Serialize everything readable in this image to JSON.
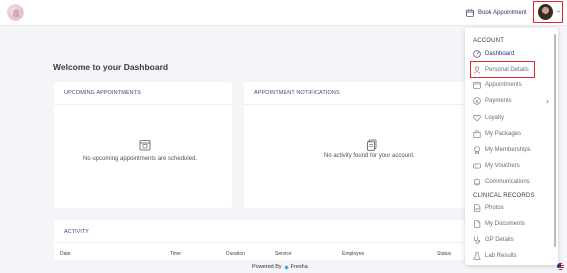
{
  "header": {
    "book_label": "Book Appointment"
  },
  "main": {
    "welcome": "Welcome to your Dashboard",
    "upcoming": {
      "title": "UPCOMING APPOINTMENTS",
      "empty_text": "No upcoming appointments are scheduled."
    },
    "notifications": {
      "title": "APPOINTMENT NOTIFICATIONS",
      "empty_text": "No activity found for your account."
    },
    "activity": {
      "title": "ACTIVITY",
      "columns": [
        "Date",
        "Time",
        "Duration",
        "Service",
        "Employee",
        "Status"
      ]
    }
  },
  "footer": {
    "powered_by": "Powered By",
    "brand": "Fresha"
  },
  "menu": {
    "account_heading": "ACCOUNT",
    "clinical_heading": "CLINICAL RECORDS",
    "items": [
      {
        "label": "Dashboard",
        "icon": "dashboard-icon"
      },
      {
        "label": "Personal Details",
        "icon": "user-icon"
      },
      {
        "label": "Appointments",
        "icon": "calendar-icon"
      },
      {
        "label": "Payments",
        "icon": "dollar-icon"
      },
      {
        "label": "Loyalty",
        "icon": "heart-icon"
      },
      {
        "label": "My Packages",
        "icon": "package-icon"
      },
      {
        "label": "My Memberships",
        "icon": "badge-icon"
      },
      {
        "label": "My Vouchers",
        "icon": "voucher-icon"
      },
      {
        "label": "Communications",
        "icon": "bell-icon"
      },
      {
        "label": "Photos",
        "icon": "photo-icon"
      },
      {
        "label": "My Documents",
        "icon": "document-icon"
      },
      {
        "label": "GP Details",
        "icon": "stethoscope-icon"
      },
      {
        "label": "Lab Results",
        "icon": "flask-icon"
      }
    ]
  },
  "colors": {
    "accent": "#3d2f7a",
    "highlight": "#e3262e",
    "background": "#f4f5f8"
  }
}
